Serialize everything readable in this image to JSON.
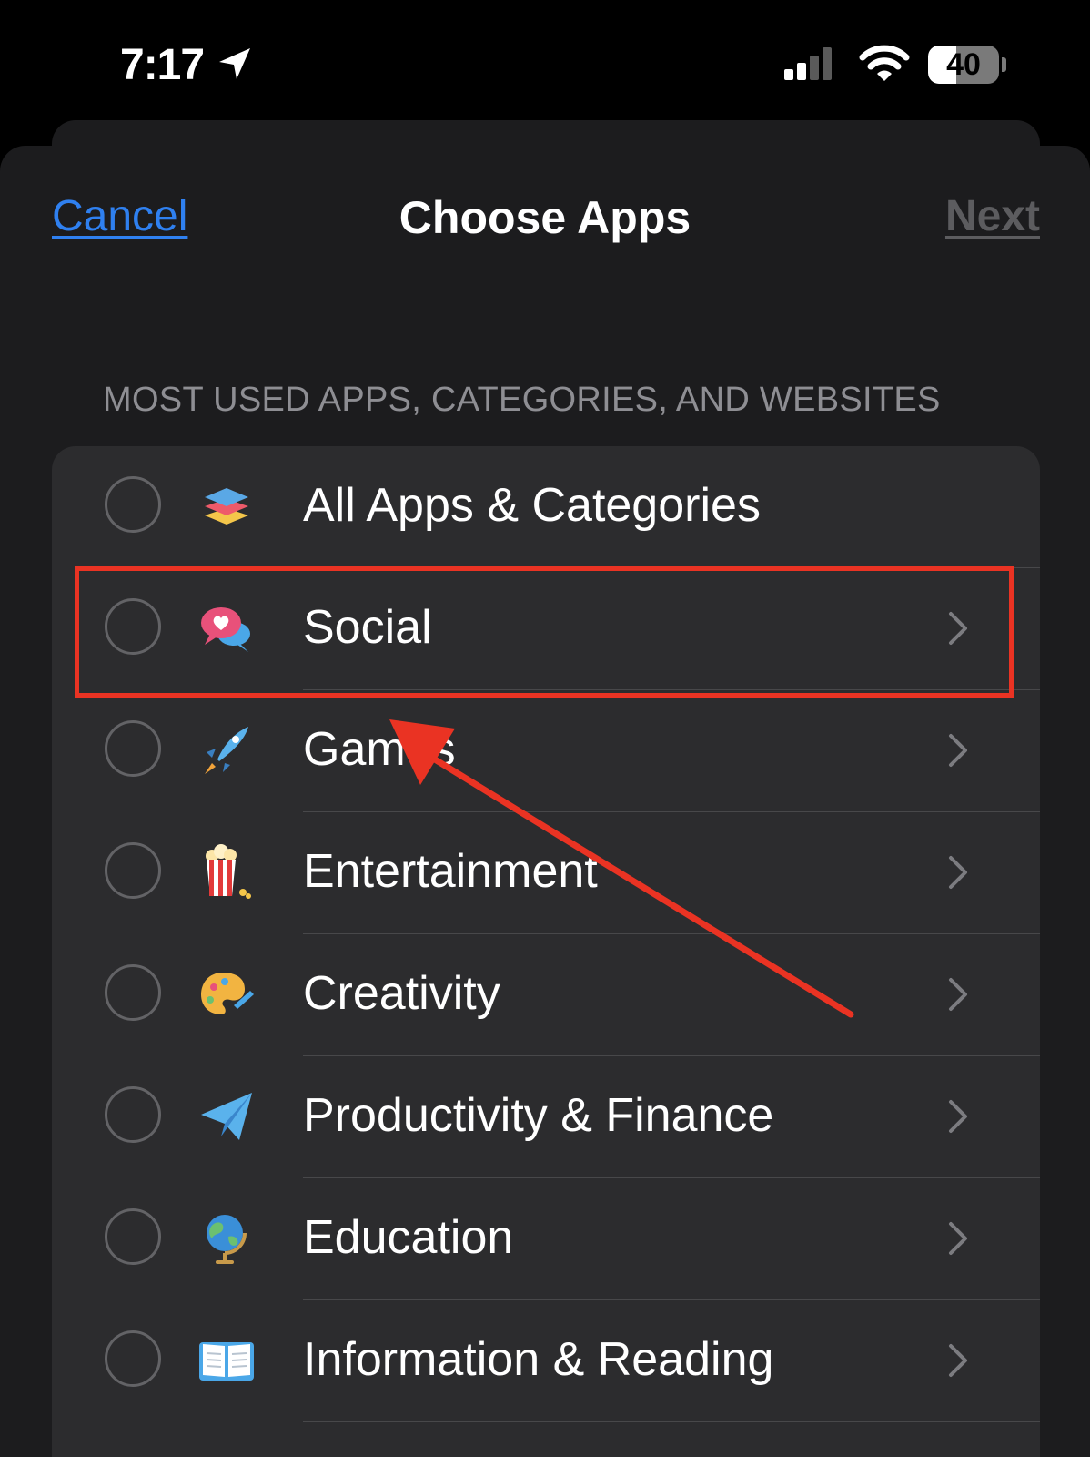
{
  "status_bar": {
    "time": "7:17",
    "battery": "40",
    "battery_percent": 40,
    "icons": [
      "location-arrow-icon",
      "cellular-signal-icon",
      "wifi-icon",
      "battery-icon"
    ]
  },
  "nav": {
    "cancel_label": "Cancel",
    "title": "Choose Apps",
    "next_label": "Next"
  },
  "section_header": "MOST USED APPS, CATEGORIES, AND WEBSITES",
  "items": [
    {
      "label": "All Apps & Categories",
      "icon": "stack-layers-icon",
      "chevron": false
    },
    {
      "label": "Social",
      "icon": "speech-bubbles-heart-icon",
      "chevron": true
    },
    {
      "label": "Games",
      "icon": "rocket-icon",
      "chevron": true
    },
    {
      "label": "Entertainment",
      "icon": "popcorn-icon",
      "chevron": true
    },
    {
      "label": "Creativity",
      "icon": "palette-icon",
      "chevron": true
    },
    {
      "label": "Productivity & Finance",
      "icon": "paper-plane-icon",
      "chevron": true
    },
    {
      "label": "Education",
      "icon": "globe-icon",
      "chevron": true
    },
    {
      "label": "Information & Reading",
      "icon": "open-book-icon",
      "chevron": true
    }
  ],
  "colors": {
    "accent": "#2f80f0",
    "annotation": "#ea3323",
    "background": "#000000",
    "sheet": "#1c1c1e",
    "list": "#2c2c2e"
  }
}
